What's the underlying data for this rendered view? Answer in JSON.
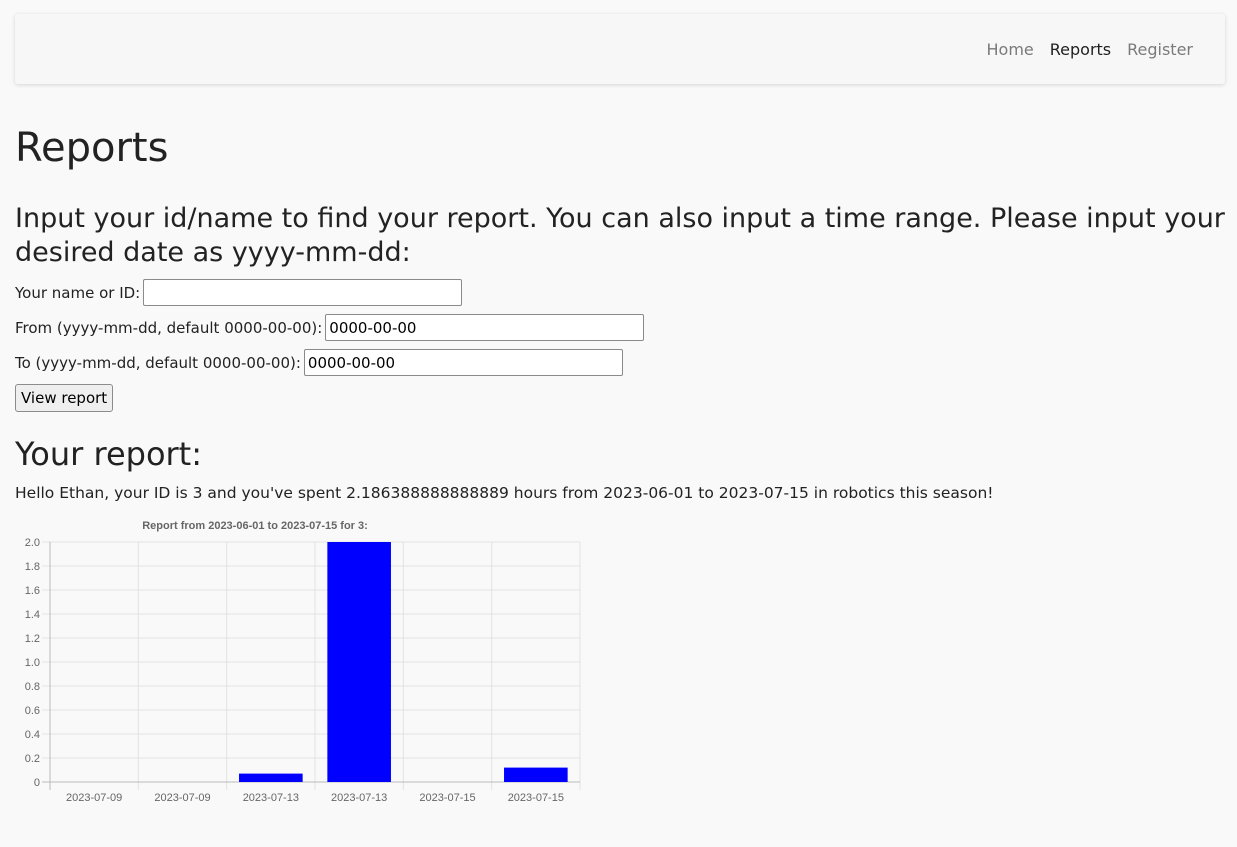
{
  "nav": {
    "links": [
      "Home",
      "Reports",
      "Register"
    ],
    "active": "Reports"
  },
  "page": {
    "title": "Reports",
    "prompt": "Input your id/name to find your report. You can also input a time range. Please input your desired date as yyyy-mm-dd:"
  },
  "form": {
    "name_label": "Your name or ID:",
    "name_value": "",
    "from_label": "From (yyyy-mm-dd, default 0000-00-00):",
    "from_value": "0000-00-00",
    "to_label": "To (yyyy-mm-dd, default 0000-00-00):",
    "to_value": "0000-00-00",
    "submit_label": "View report"
  },
  "report": {
    "heading": "Your report:",
    "summary": "Hello Ethan, your ID is 3 and you've spent 2.186388888888889 hours from 2023-06-01 to 2023-07-15 in robotics this season!"
  },
  "chart_data": {
    "type": "bar",
    "title": "Report from 2023-06-01 to 2023-07-15 for 3:",
    "categories": [
      "2023-07-09",
      "2023-07-09",
      "2023-07-13",
      "2023-07-13",
      "2023-07-15",
      "2023-07-15"
    ],
    "values": [
      0,
      0,
      0.07,
      2.0,
      0,
      0.12
    ],
    "ylim": [
      0,
      2.0
    ],
    "yticks": [
      "0",
      "0.2",
      "0.4",
      "0.6",
      "0.8",
      "1.0",
      "1.2",
      "1.4",
      "1.6",
      "1.8",
      "2.0"
    ],
    "grid": true,
    "bar_color": "#0000ff"
  }
}
